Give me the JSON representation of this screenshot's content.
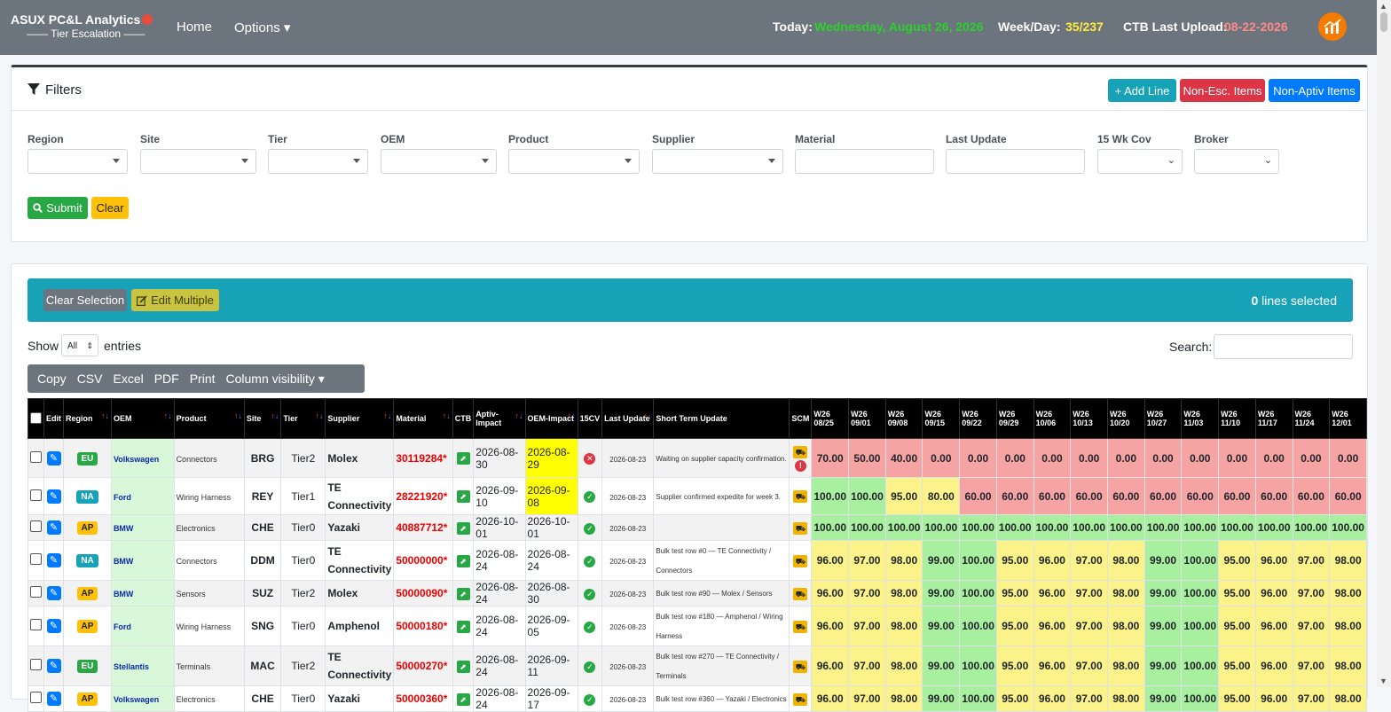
{
  "nav": {
    "brand_title": "ASUX PC&L Analytics",
    "brand_sub": "—— Tier Escalation ——",
    "home": "Home",
    "options": "Options ▾",
    "today_label": "Today:",
    "today_value": "Wednesday, August 26, 2026",
    "weekday_label": "Week/Day:",
    "weekday_value": "35/237",
    "ctb_label": "CTB Last Upload:",
    "ctb_value": "08-22-2026"
  },
  "filters": {
    "title": "Filters",
    "add_line": "+ Add Line",
    "non_esc": "Non-Esc. Items",
    "non_aptiv": "Non-Aptiv Items",
    "labels": [
      "Region",
      "Site",
      "Tier",
      "OEM",
      "Product",
      "Supplier",
      "Material",
      "Last Update",
      "15 Wk Cov",
      "Broker"
    ],
    "submit": "Submit",
    "clear": "Clear"
  },
  "table_controls": {
    "clear_selection": "Clear Selection",
    "edit_multiple": "Edit Multiple",
    "selected_count": "0",
    "selected_text": " lines selected",
    "show": "Show",
    "entries_value": "All",
    "entries": "entries",
    "search_label": "Search:",
    "buttons": [
      "Copy",
      "CSV",
      "Excel",
      "PDF",
      "Print",
      "Column visibility ▾"
    ]
  },
  "columns": [
    "",
    "Edit",
    "Region",
    "OEM",
    "Product",
    "Site",
    "Tier",
    "Supplier",
    "Material",
    "CTB",
    "Aptiv-Impact",
    "OEM-Impact",
    "15CV",
    "Last Update",
    "Short Term Update",
    "SCM"
  ],
  "weeks": [
    {
      "w": "W26",
      "d": "08/25"
    },
    {
      "w": "W26",
      "d": "09/01"
    },
    {
      "w": "W26",
      "d": "09/08"
    },
    {
      "w": "W26",
      "d": "09/15"
    },
    {
      "w": "W26",
      "d": "09/22"
    },
    {
      "w": "W26",
      "d": "09/29"
    },
    {
      "w": "W26",
      "d": "10/06"
    },
    {
      "w": "W26",
      "d": "10/13"
    },
    {
      "w": "W26",
      "d": "10/20"
    },
    {
      "w": "W26",
      "d": "10/27"
    },
    {
      "w": "W26",
      "d": "11/03"
    },
    {
      "w": "W26",
      "d": "11/10"
    },
    {
      "w": "W26",
      "d": "11/17"
    },
    {
      "w": "W26",
      "d": "11/24"
    },
    {
      "w": "W26",
      "d": "12/01"
    }
  ],
  "colors": {
    "red": "#f5a3a3",
    "green": "#a8f0a0",
    "yellow": "#fbf38a",
    "oem_yellow": "#ffff00"
  },
  "rows": [
    {
      "region": "EU",
      "region_color": "#28a745",
      "oem": "Volkswagen",
      "product": "Connectors",
      "site": "BRG",
      "tier": "Tier2",
      "supplier": "Molex",
      "material": "30119284*",
      "aptiv": "2026-08-30",
      "oem_impact": "2026-08-29",
      "oem_hl": true,
      "cv": "bad",
      "last": "2026-08-23",
      "update": "Waiting on supplier capacity confirmation.",
      "scm_alert": true,
      "vals": [
        "70.00",
        "50.00",
        "40.00",
        "0.00",
        "0.00",
        "0.00",
        "0.00",
        "0.00",
        "0.00",
        "0.00",
        "0.00",
        "0.00",
        "0.00",
        "0.00",
        "0.00"
      ],
      "cols": [
        "r",
        "r",
        "r",
        "r",
        "r",
        "r",
        "r",
        "r",
        "r",
        "r",
        "r",
        "r",
        "r",
        "r",
        "r"
      ]
    },
    {
      "region": "NA",
      "region_color": "#17a2b8",
      "oem": "Ford",
      "product": "Wiring Harness",
      "site": "REY",
      "tier": "Tier1",
      "supplier": "TE Connectivity",
      "material": "28221920*",
      "aptiv": "2026-09-10",
      "oem_impact": "2026-09-08",
      "oem_hl": true,
      "cv": "ok",
      "last": "2026-08-23",
      "update": "Supplier confirmed expedite for week 3.",
      "scm_alert": false,
      "vals": [
        "100.00",
        "100.00",
        "95.00",
        "80.00",
        "60.00",
        "60.00",
        "60.00",
        "60.00",
        "60.00",
        "60.00",
        "60.00",
        "60.00",
        "60.00",
        "60.00",
        "60.00"
      ],
      "cols": [
        "g",
        "g",
        "y",
        "y",
        "r",
        "r",
        "r",
        "r",
        "r",
        "r",
        "r",
        "r",
        "r",
        "r",
        "r"
      ]
    },
    {
      "region": "AP",
      "region_color": "#ffc107",
      "oem": "BMW",
      "product": "Electronics",
      "site": "CHE",
      "tier": "Tier0",
      "supplier": "Yazaki",
      "material": "40887712*",
      "aptiv": "2026-10-01",
      "oem_impact": "2026-10-01",
      "oem_hl": false,
      "cv": "ok",
      "last": "2026-08-23",
      "update": "",
      "scm_alert": false,
      "vals": [
        "100.00",
        "100.00",
        "100.00",
        "100.00",
        "100.00",
        "100.00",
        "100.00",
        "100.00",
        "100.00",
        "100.00",
        "100.00",
        "100.00",
        "100.00",
        "100.00",
        "100.00"
      ],
      "cols": [
        "g",
        "g",
        "g",
        "g",
        "g",
        "g",
        "g",
        "g",
        "g",
        "g",
        "g",
        "g",
        "g",
        "g",
        "g"
      ]
    },
    {
      "region": "NA",
      "region_color": "#17a2b8",
      "oem": "BMW",
      "product": "Connectors",
      "site": "DDM",
      "tier": "Tier0",
      "supplier": "TE Connectivity",
      "material": "50000000*",
      "aptiv": "2026-08-24",
      "oem_impact": "2026-08-24",
      "oem_hl": false,
      "cv": "ok",
      "last": "2026-08-23",
      "update": "Bulk test row #0 — TE Connectivity / Connectors",
      "scm_alert": false,
      "vals": [
        "96.00",
        "97.00",
        "98.00",
        "99.00",
        "100.00",
        "95.00",
        "96.00",
        "97.00",
        "98.00",
        "99.00",
        "100.00",
        "95.00",
        "96.00",
        "97.00",
        "98.00"
      ],
      "cols": [
        "y",
        "y",
        "y",
        "g",
        "g",
        "y",
        "y",
        "y",
        "y",
        "g",
        "g",
        "y",
        "y",
        "y",
        "y"
      ]
    },
    {
      "region": "AP",
      "region_color": "#ffc107",
      "oem": "BMW",
      "product": "Sensors",
      "site": "SUZ",
      "tier": "Tier2",
      "supplier": "Molex",
      "material": "50000090*",
      "aptiv": "2026-08-24",
      "oem_impact": "2026-08-30",
      "oem_hl": false,
      "cv": "ok",
      "last": "2026-08-23",
      "update": "Bulk test row #90 — Molex / Sensors",
      "scm_alert": false,
      "vals": [
        "96.00",
        "97.00",
        "98.00",
        "99.00",
        "100.00",
        "95.00",
        "96.00",
        "97.00",
        "98.00",
        "99.00",
        "100.00",
        "95.00",
        "96.00",
        "97.00",
        "98.00"
      ],
      "cols": [
        "y",
        "y",
        "y",
        "g",
        "g",
        "y",
        "y",
        "y",
        "y",
        "g",
        "g",
        "y",
        "y",
        "y",
        "y"
      ]
    },
    {
      "region": "AP",
      "region_color": "#ffc107",
      "oem": "Ford",
      "product": "Wiring Harness",
      "site": "SNG",
      "tier": "Tier0",
      "supplier": "Amphenol",
      "material": "50000180*",
      "aptiv": "2026-08-24",
      "oem_impact": "2026-09-05",
      "oem_hl": false,
      "cv": "ok",
      "last": "2026-08-23",
      "update": "Bulk test row #180 — Amphenol / Wiring Harness",
      "scm_alert": false,
      "vals": [
        "96.00",
        "97.00",
        "98.00",
        "99.00",
        "100.00",
        "95.00",
        "96.00",
        "97.00",
        "98.00",
        "99.00",
        "100.00",
        "95.00",
        "96.00",
        "97.00",
        "98.00"
      ],
      "cols": [
        "y",
        "y",
        "y",
        "g",
        "g",
        "y",
        "y",
        "y",
        "y",
        "g",
        "g",
        "y",
        "y",
        "y",
        "y"
      ]
    },
    {
      "region": "EU",
      "region_color": "#28a745",
      "oem": "Stellantis",
      "product": "Terminals",
      "site": "MAC",
      "tier": "Tier2",
      "supplier": "TE Connectivity",
      "material": "50000270*",
      "aptiv": "2026-08-24",
      "oem_impact": "2026-09-11",
      "oem_hl": false,
      "cv": "ok",
      "last": "2026-08-23",
      "update": "Bulk test row #270 — TE Connectivity / Terminals",
      "scm_alert": false,
      "vals": [
        "96.00",
        "97.00",
        "98.00",
        "99.00",
        "100.00",
        "95.00",
        "96.00",
        "97.00",
        "98.00",
        "99.00",
        "100.00",
        "95.00",
        "96.00",
        "97.00",
        "98.00"
      ],
      "cols": [
        "y",
        "y",
        "y",
        "g",
        "g",
        "y",
        "y",
        "y",
        "y",
        "g",
        "g",
        "y",
        "y",
        "y",
        "y"
      ]
    },
    {
      "region": "AP",
      "region_color": "#ffc107",
      "oem": "Volkswagen",
      "product": "Electronics",
      "site": "CHE",
      "tier": "Tier0",
      "supplier": "Yazaki",
      "material": "50000360*",
      "aptiv": "2026-08-24",
      "oem_impact": "2026-09-17",
      "oem_hl": false,
      "cv": "ok",
      "last": "2026-08-23",
      "update": "Bulk test row #360 — Yazaki / Electronics",
      "scm_alert": false,
      "vals": [
        "96.00",
        "97.00",
        "98.00",
        "99.00",
        "100.00",
        "95.00",
        "96.00",
        "97.00",
        "98.00",
        "99.00",
        "100.00",
        "95.00",
        "96.00",
        "97.00",
        "98.00"
      ],
      "cols": [
        "y",
        "y",
        "y",
        "g",
        "g",
        "y",
        "y",
        "y",
        "y",
        "g",
        "g",
        "y",
        "y",
        "y",
        "y"
      ]
    }
  ]
}
